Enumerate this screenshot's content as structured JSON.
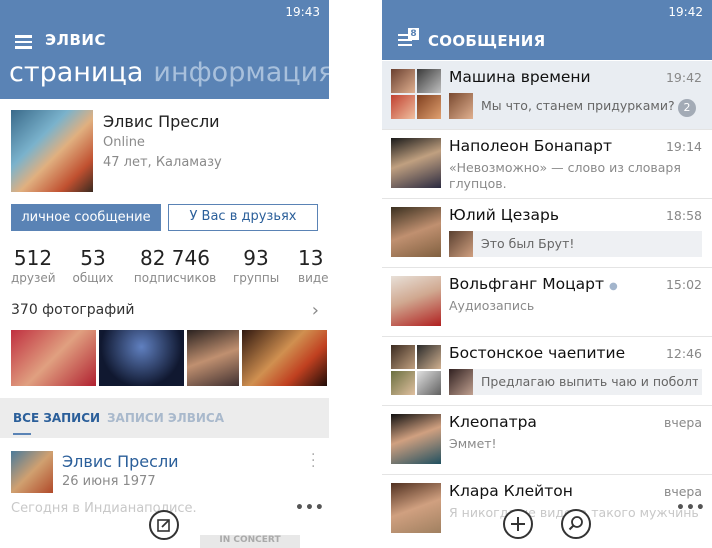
{
  "left": {
    "time": "19:43",
    "header_title": "ЭЛВИС",
    "pivot_active": "страница",
    "pivot_inactive": "информация",
    "profile": {
      "name": "Элвис Пресли",
      "status": "Online",
      "info": "47 лет, Каламазу"
    },
    "buttons": {
      "message": "личное сообщение",
      "friends": "У Вас в друзьях"
    },
    "stats": [
      {
        "num": "512",
        "label": "друзей"
      },
      {
        "num": "53",
        "label": "общих"
      },
      {
        "num": "82 746",
        "label": "подписчиков"
      },
      {
        "num": "93",
        "label": "группы"
      },
      {
        "num": "13",
        "label": "видео"
      }
    ],
    "photos_title": "370 фотографий",
    "tabs": {
      "all": "ВСЕ ЗАПИСИ",
      "elvis": "ЗАПИСИ ЭЛВИСА"
    },
    "post": {
      "author": "Элвис Пресли",
      "date": "26 июня 1977",
      "text": "Сегодня в Индианаполисе.",
      "image_caption": "IN CONCERT"
    }
  },
  "right": {
    "time": "19:42",
    "badge": "8",
    "header_title": "СООБЩЕНИЯ",
    "dialogs": [
      {
        "title": "Машина времени",
        "time": "19:42",
        "text": "Мы что, станем придурками?",
        "unread": "2"
      },
      {
        "title": "Наполеон Бонапарт",
        "time": "19:14",
        "text": "«Невозможно» — слово из словаря глупцов."
      },
      {
        "title": "Юлий Цезарь",
        "time": "18:58",
        "text": "Это был Брут!"
      },
      {
        "title": "Вольфганг Моцарт",
        "time": "15:02",
        "text": "Аудиозапись"
      },
      {
        "title": "Бостонское чаепитие",
        "time": "12:46",
        "text": "Предлагаю выпить чаю и поболтать"
      },
      {
        "title": "Клеопатра",
        "time": "вчера",
        "text": "Эммет!"
      },
      {
        "title": "Клара Клейтон",
        "time": "вчера",
        "text": "Я никогда не видела такого мужчины как ты"
      }
    ]
  }
}
